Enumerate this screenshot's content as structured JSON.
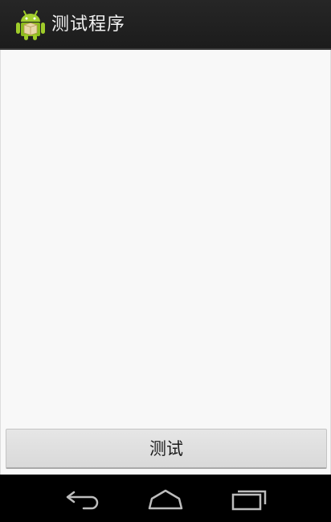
{
  "action_bar": {
    "title": "测试程序",
    "icon": "android-robot-icon"
  },
  "main": {
    "button_label": "测试"
  },
  "nav_bar": {
    "back_icon": "back-arrow-icon",
    "home_icon": "home-icon",
    "recent_icon": "recent-apps-icon"
  },
  "colors": {
    "action_bar_bg": "#222222",
    "content_bg": "#f8f8f8",
    "button_bg": "#dedede",
    "android_green": "#97c024",
    "nav_bar_bg": "#000000"
  }
}
